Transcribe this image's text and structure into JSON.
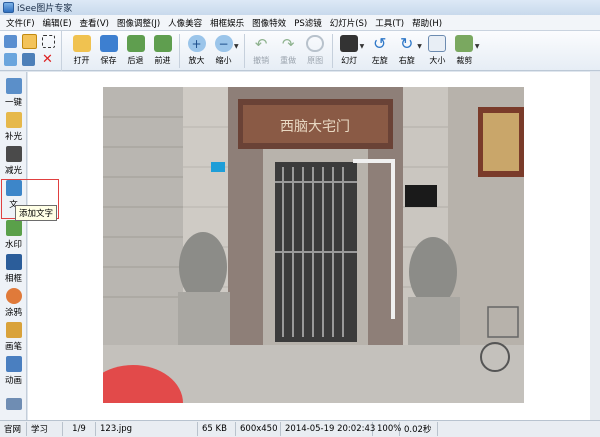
{
  "window": {
    "title": "iSee图片专家"
  },
  "menu": [
    "文件(F)",
    "编辑(E)",
    "查看(V)",
    "图像调整(J)",
    "人像美容",
    "相框娱乐",
    "图像特效",
    "PS滤镜",
    "幻灯片(S)",
    "工具(T)",
    "帮助(H)"
  ],
  "toolbar": {
    "open": "打开",
    "save": "保存",
    "back": "后退",
    "forward": "前进",
    "zoom_in": "放大",
    "zoom_out": "缩小",
    "undo": "撤销",
    "redo": "重做",
    "original": "原图",
    "slideshow": "幻灯",
    "rotate_left": "左旋",
    "rotate_right": "右旋",
    "size": "大小",
    "crop": "裁剪"
  },
  "left_tools": [
    "一键",
    "补光",
    "减光",
    "文",
    "水印",
    "相框",
    "涂鸦",
    "画笔",
    "动画"
  ],
  "tooltip": "添加文字",
  "status": {
    "tab1": "官网",
    "tab2": "学习",
    "page": "1/9",
    "filename": "123.jpg",
    "filesize": "65 KB",
    "dimensions": "600x450",
    "datetime": "2014-05-19 20:02:43",
    "zoom": "100%",
    "time": "0.02秒"
  },
  "photo": {
    "sign": "西脑大宅门"
  },
  "colors": {
    "accent": "#2f6fbf",
    "highlight": "#e04040",
    "tooltip_bg": "#ffffe6"
  }
}
